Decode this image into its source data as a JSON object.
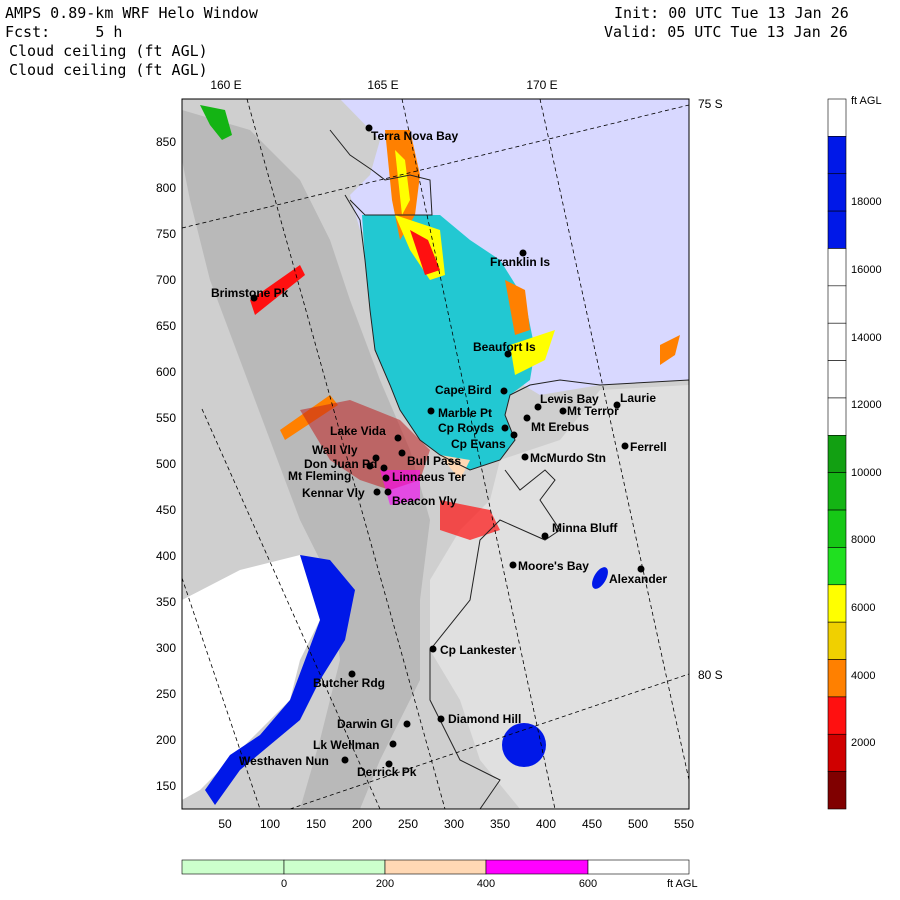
{
  "header": {
    "title": "AMPS 0.89-km WRF Helo Window",
    "fcst_label": "Fcst:",
    "fcst_value": "5 h",
    "field1": "Cloud ceiling (ft AGL)",
    "field2": "Cloud ceiling (ft AGL)",
    "init_label": "Init:",
    "init_value": "00 UTC Tue 13 Jan 26",
    "valid_label": "Valid:",
    "valid_value": "05 UTC Tue 13 Jan 26"
  },
  "map": {
    "lon_labels": [
      "160 E",
      "165 E",
      "170 E"
    ],
    "lat_labels": [
      "75 S",
      "80 S"
    ],
    "x_ticks": [
      "50",
      "100",
      "150",
      "200",
      "250",
      "300",
      "350",
      "400",
      "450",
      "500",
      "550"
    ],
    "y_ticks": [
      "850",
      "800",
      "750",
      "700",
      "650",
      "600",
      "550",
      "500",
      "450",
      "400",
      "350",
      "300",
      "250",
      "200",
      "150"
    ],
    "places": [
      {
        "name": "Terra Nova Bay"
      },
      {
        "name": "Franklin Is"
      },
      {
        "name": "Brimstone Pk"
      },
      {
        "name": "Beaufort Is"
      },
      {
        "name": "Cape Bird"
      },
      {
        "name": "Lewis Bay"
      },
      {
        "name": "Laurie"
      },
      {
        "name": "Mt Terror"
      },
      {
        "name": "Marble Pt"
      },
      {
        "name": "Cp Royds"
      },
      {
        "name": "Mt Erebus"
      },
      {
        "name": "Lake Vida"
      },
      {
        "name": "Cp Evans"
      },
      {
        "name": "Ferrell"
      },
      {
        "name": "Wall Vly"
      },
      {
        "name": "Bull Pass"
      },
      {
        "name": "Don Juan Pd"
      },
      {
        "name": "McMurdo Stn"
      },
      {
        "name": "Mt Fleming"
      },
      {
        "name": "Linnaeus Ter"
      },
      {
        "name": "Kennar Vly"
      },
      {
        "name": "Beacon Vly"
      },
      {
        "name": "Minna Bluff"
      },
      {
        "name": "Moore's Bay"
      },
      {
        "name": "Alexander"
      },
      {
        "name": "Cp Lankester"
      },
      {
        "name": "Butcher Rdg"
      },
      {
        "name": "Darwin Gl"
      },
      {
        "name": "Diamond Hill"
      },
      {
        "name": "Lk Wellman"
      },
      {
        "name": "Westhaven Nun"
      },
      {
        "name": "Derrick Pk"
      }
    ]
  },
  "colorbar": {
    "unit": "ft AGL",
    "labels": [
      "18000",
      "16000",
      "14000",
      "12000",
      "10000",
      "8000",
      "6000",
      "4000",
      "2000"
    ],
    "colors": [
      "#ffffff",
      "#0018e8",
      "#0018e8",
      "#0018e8",
      "#ffffff",
      "#ffffff",
      "#ffffff",
      "#ffffff",
      "#ffffff",
      "#12a012",
      "#14b414",
      "#16c816",
      "#20e020",
      "#ffff00",
      "#f0d000",
      "#ff8000",
      "#ff1010",
      "#d00000",
      "#800000"
    ]
  },
  "bottom_bar": {
    "unit": "ft AGL",
    "labels": [
      "0",
      "200",
      "400",
      "600"
    ],
    "colors": [
      "#ccffcc",
      "#ccffcc",
      "#ffd8b4",
      "#ff00ff",
      "#ffffff"
    ]
  },
  "palette": {
    "ocean_ice": "#d8d8ff",
    "cyan_cloud": "#20c8d0",
    "land_gray": "#c8c8c8",
    "blue_cloud": "#0018e8"
  }
}
